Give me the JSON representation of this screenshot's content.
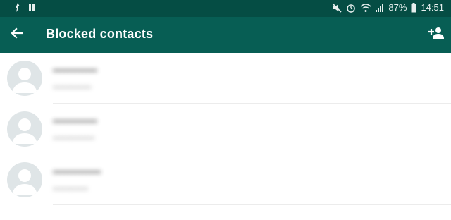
{
  "status_bar": {
    "battery": "87%",
    "time": "14:51"
  },
  "app_bar": {
    "title": "Blocked contacts",
    "back_icon": "arrow-back-icon",
    "action_icon": "person-add-icon"
  },
  "contacts": [
    {
      "name": "••••••••••••",
      "subtitle": "••••••••••••"
    },
    {
      "name": "••••••••••••",
      "subtitle": "•••••••••••••"
    },
    {
      "name": "•••••••••••••",
      "subtitle": "•••••••••••"
    }
  ],
  "colors": {
    "status_bar": "#054d44",
    "app_bar": "#075e54",
    "avatar_bg": "#dfe5e7"
  }
}
